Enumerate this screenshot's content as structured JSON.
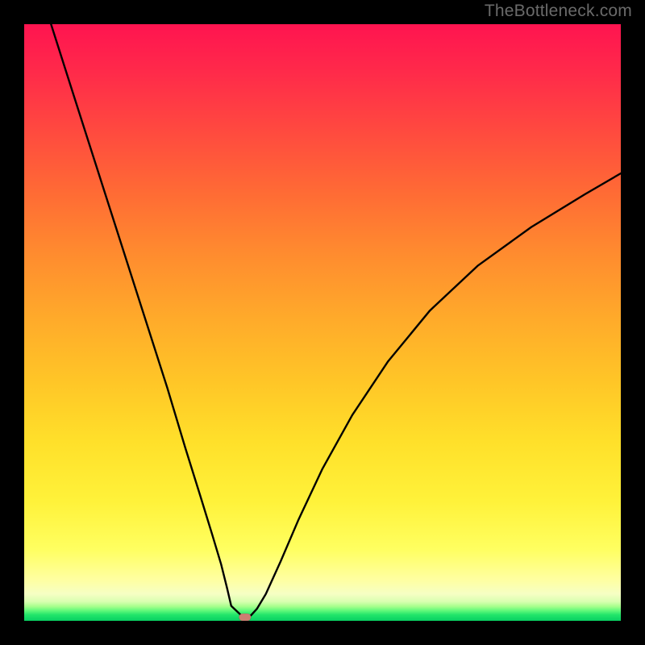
{
  "watermark": {
    "text": "TheBottleneck.com"
  },
  "colors": {
    "background": "#000000",
    "gradient_top": "#ff1450",
    "gradient_mid": "#ffe02a",
    "gradient_bottom": "#08d062",
    "curve": "#000000",
    "marker": "#cc7e72"
  },
  "chart_data": {
    "type": "line",
    "title": "",
    "xlabel": "",
    "ylabel": "",
    "xlim": [
      0,
      100
    ],
    "ylim": [
      0,
      100
    ],
    "grid": false,
    "legend": false,
    "annotations": [
      "TheBottleneck.com"
    ],
    "series": [
      {
        "name": "bottleneck-curve",
        "x": [
          4.5,
          8,
          12,
          16,
          20,
          24,
          27,
          29.5,
          31.5,
          33,
          34,
          34.7,
          36.5,
          37.2,
          38,
          39,
          40.5,
          43,
          46,
          50,
          55,
          61,
          68,
          76,
          85,
          94,
          100
        ],
        "y": [
          100,
          89,
          76.5,
          64,
          51.5,
          39,
          29,
          21,
          14.5,
          9.5,
          5.5,
          2.5,
          0.8,
          0.6,
          0.9,
          2.0,
          4.5,
          10,
          17,
          25.5,
          34.5,
          43.5,
          52,
          59.5,
          66,
          71.5,
          75
        ]
      }
    ],
    "marker": {
      "x": 37,
      "y": 0.6,
      "shape": "capsule"
    }
  }
}
